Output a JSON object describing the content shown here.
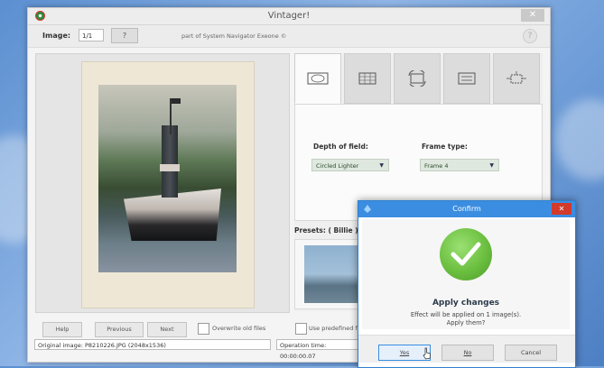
{
  "window": {
    "title": "Vintager!",
    "close_label": "✕"
  },
  "toolbar": {
    "image_label": "Image:",
    "image_value": "1/1",
    "button_label": "?",
    "credit": "part of System Navigator Exeone ©"
  },
  "options": {
    "depth_label": "Depth of field:",
    "depth_value": "Circled Lighter",
    "frame_label": "Frame type:",
    "frame_value": "Frame 4",
    "presets_label": "Presets: ( Billie )"
  },
  "tabs": [
    {
      "icon": "vignette-icon"
    },
    {
      "icon": "frame-grid-icon"
    },
    {
      "icon": "rotate-image-icon"
    },
    {
      "icon": "adjust-lines-icon"
    },
    {
      "icon": "crop-image-icon"
    }
  ],
  "bottom": {
    "help": "Help",
    "previous": "Previous",
    "next": "Next",
    "overwrite": "Overwrite old files",
    "predefined": "Use predefined fra"
  },
  "status": {
    "original": "Original image: P8210226.JPG (2048x1536)",
    "operation": "Operation time: 00:00:00.07"
  },
  "dialog": {
    "title": "Confirm",
    "close_label": "✕",
    "heading": "Apply changes",
    "line1": "Effect will be applied on 1 image(s).",
    "line2": "Apply them?",
    "yes": "Yes",
    "no": "No",
    "cancel": "Cancel"
  },
  "colors": {
    "dialog_accent": "#3a8de0",
    "success_green": "#6bbf3f",
    "close_red": "#d23a2c"
  }
}
